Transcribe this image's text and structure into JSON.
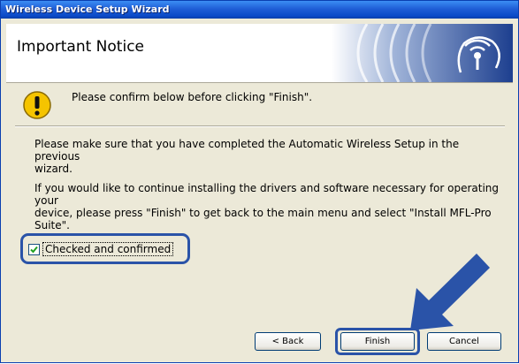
{
  "window": {
    "title": "Wireless Device Setup Wizard"
  },
  "header": {
    "title": "Important Notice"
  },
  "notice": {
    "text": "Please confirm below before clicking \"Finish\"."
  },
  "body": {
    "paragraph1_line1": "Please make sure that you have completed the Automatic Wireless Setup in the previous",
    "paragraph1_line2": "wizard.",
    "paragraph2_line1": "If you would like to continue installing the drivers and software necessary for operating your",
    "paragraph2_line2": "device, please press \"Finish\" to get back to the main menu and select \"Install MFL-Pro",
    "paragraph2_line3": "Suite\"."
  },
  "checkbox": {
    "label": "Checked and confirmed",
    "checked": true
  },
  "buttons": {
    "back": "< Back",
    "finish": "Finish",
    "cancel": "Cancel"
  },
  "colors": {
    "titlebar": "#0a4ac8",
    "highlight": "#2a53a8",
    "dialog_bg": "#ece9d8"
  },
  "icons": [
    "warning-icon",
    "wireless-icon",
    "pointer-arrow"
  ]
}
